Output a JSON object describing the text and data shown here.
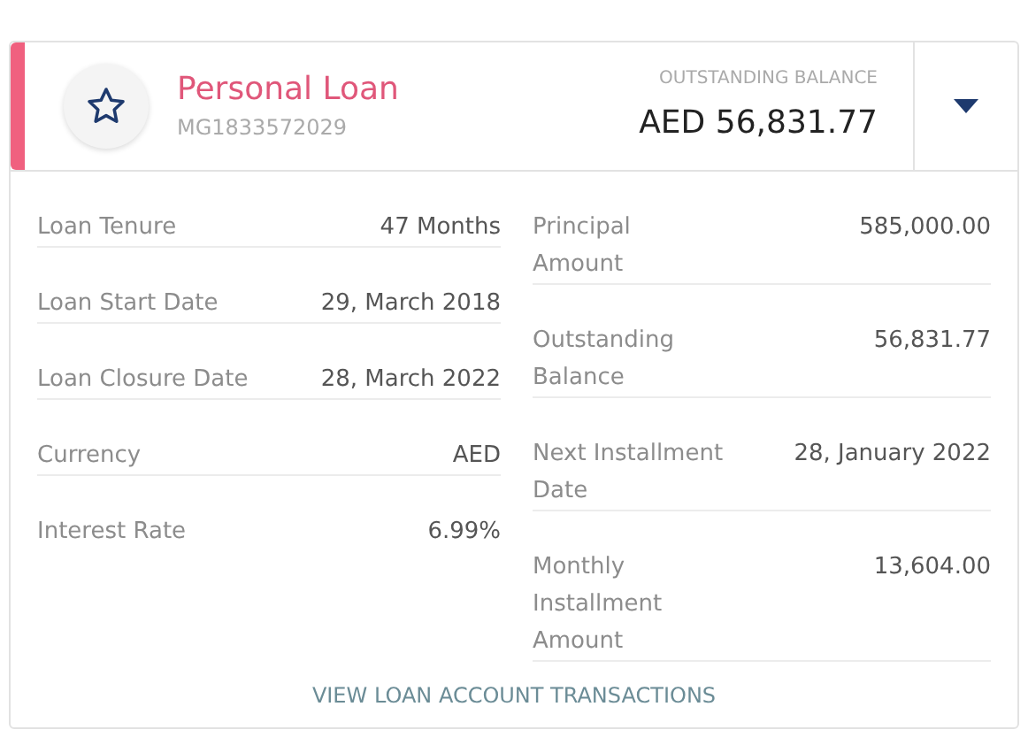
{
  "loan": {
    "title": "Personal Loan",
    "account_number": "MG1833572029",
    "balance_label": "OUTSTANDING BALANCE",
    "balance": "AED 56,831.77"
  },
  "left_details": [
    {
      "label": "Loan Tenure",
      "value": "47 Months"
    },
    {
      "label": "Loan Start Date",
      "value": "29, March 2018"
    },
    {
      "label": "Loan Closure Date",
      "value": "28, March 2022"
    },
    {
      "label": "Currency",
      "value": "AED"
    },
    {
      "label": "Interest Rate",
      "value": "6.99%"
    }
  ],
  "right_details": [
    {
      "label": "Principal Amount",
      "value": "585,000.00"
    },
    {
      "label": "Outstanding Balance",
      "value": "56,831.77"
    },
    {
      "label": "Next Installment Date",
      "value": "28, January 2022"
    },
    {
      "label": "Monthly Installment Amount",
      "value": "13,604.00"
    }
  ],
  "link": "VIEW LOAN ACCOUNT TRANSACTIONS"
}
